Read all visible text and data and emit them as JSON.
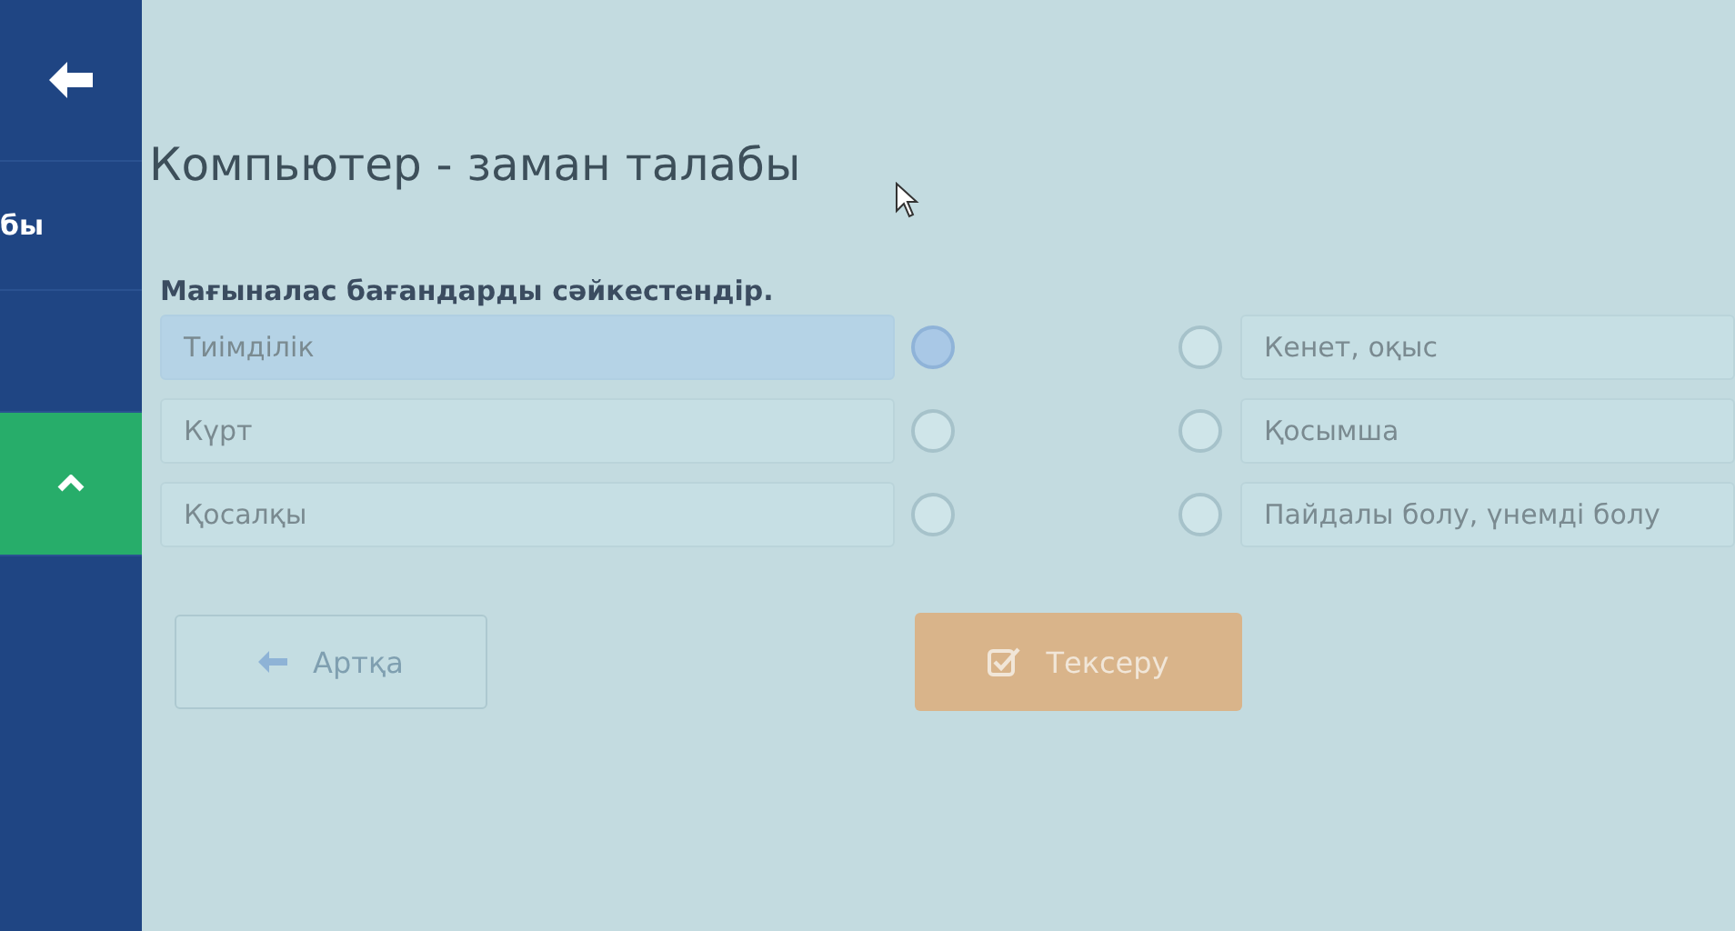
{
  "sidebar": {
    "label": "бы",
    "items": [
      {
        "kind": "back",
        "selected": false
      },
      {
        "kind": "label",
        "selected": false
      },
      {
        "kind": "blank",
        "selected": false
      },
      {
        "kind": "collapse",
        "selected": true
      }
    ]
  },
  "title": "Компьютер - заман талабы",
  "instruction": "Мағыналас бағандарды сәйкестендір.",
  "left_items": [
    {
      "text": "Тиімділік",
      "selected": true
    },
    {
      "text": "Күрт",
      "selected": false
    },
    {
      "text": "Қосалқы",
      "selected": false
    }
  ],
  "right_items": [
    {
      "text": "Кенет, оқыс",
      "selected": false
    },
    {
      "text": "Қосымша",
      "selected": false
    },
    {
      "text": "Пайдалы болу, үнемді болу",
      "selected": false
    }
  ],
  "buttons": [
    {
      "kind": "back",
      "label": "Артқа",
      "disabled": true
    },
    {
      "kind": "check",
      "label": "Тексеру",
      "disabled": false
    }
  ]
}
